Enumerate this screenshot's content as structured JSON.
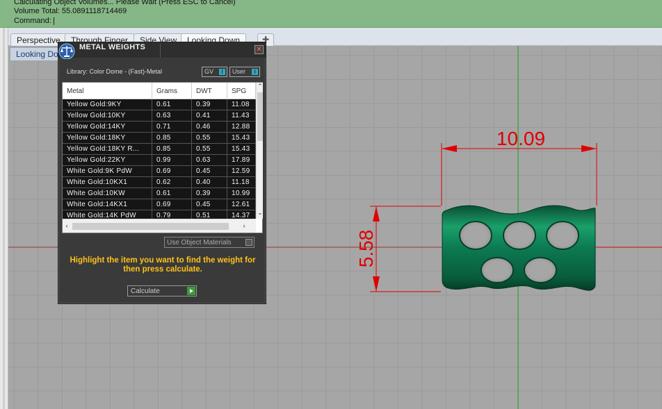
{
  "command_area": {
    "line1": "Calculating Object Volumes... Please Wait (Press ESC to Cancel)",
    "line2": "Volume Total: 55.0891118714469",
    "prompt": "Command:"
  },
  "tabs": [
    {
      "label": "Perspective"
    },
    {
      "label": "Through Finger"
    },
    {
      "label": "Side View"
    },
    {
      "label": "Looking Down"
    }
  ],
  "tab_add_icon": "plus-icon",
  "viewport": {
    "label": "Looking Down",
    "dim_width": "10.09",
    "dim_height": "5.58",
    "object_color": "#0c7a52",
    "dimension_color": "#e00000",
    "axis_color": "#2aa52a",
    "grid_color": "#9a9a9a",
    "background": "#a6a6a6"
  },
  "dialog": {
    "title": "METAL WEIGHTS",
    "close_label": "×",
    "library_label": "Library: Color Dome - (Fast)-Metal",
    "toggle_gv": "GV",
    "toggle_user": "User",
    "toggle_knob": "I",
    "columns": [
      "Metal",
      "Grams",
      "DWT",
      "SPG"
    ],
    "rows": [
      [
        "Yellow Gold:9KY",
        "0.61",
        "0.39",
        "11.08"
      ],
      [
        "Yellow Gold:10KY",
        "0.63",
        "0.41",
        "11.43"
      ],
      [
        "Yellow Gold:14KY",
        "0.71",
        "0.46",
        "12.88"
      ],
      [
        "Yellow Gold:18KY",
        "0.85",
        "0.55",
        "15.43"
      ],
      [
        "Yellow Gold:18KY R...",
        "0.85",
        "0.55",
        "15.43"
      ],
      [
        "Yellow Gold:22KY",
        "0.99",
        "0.63",
        "17.89"
      ],
      [
        "White Gold:9K PdW",
        "0.69",
        "0.45",
        "12.59"
      ],
      [
        "White Gold:10KX1",
        "0.62",
        "0.40",
        "11.18"
      ],
      [
        "White Gold:10KW",
        "0.61",
        "0.39",
        "10.99"
      ],
      [
        "White Gold:14KX1",
        "0.69",
        "0.45",
        "12.61"
      ],
      [
        "White Gold:14K PdW",
        "0.79",
        "0.51",
        "14.37"
      ]
    ],
    "use_object_materials": "Use Object Materials",
    "hint": "Highlight the item you want to find the weight for then press calculate.",
    "calculate_label": "Calculate",
    "hint_color": "#ffc21a"
  }
}
